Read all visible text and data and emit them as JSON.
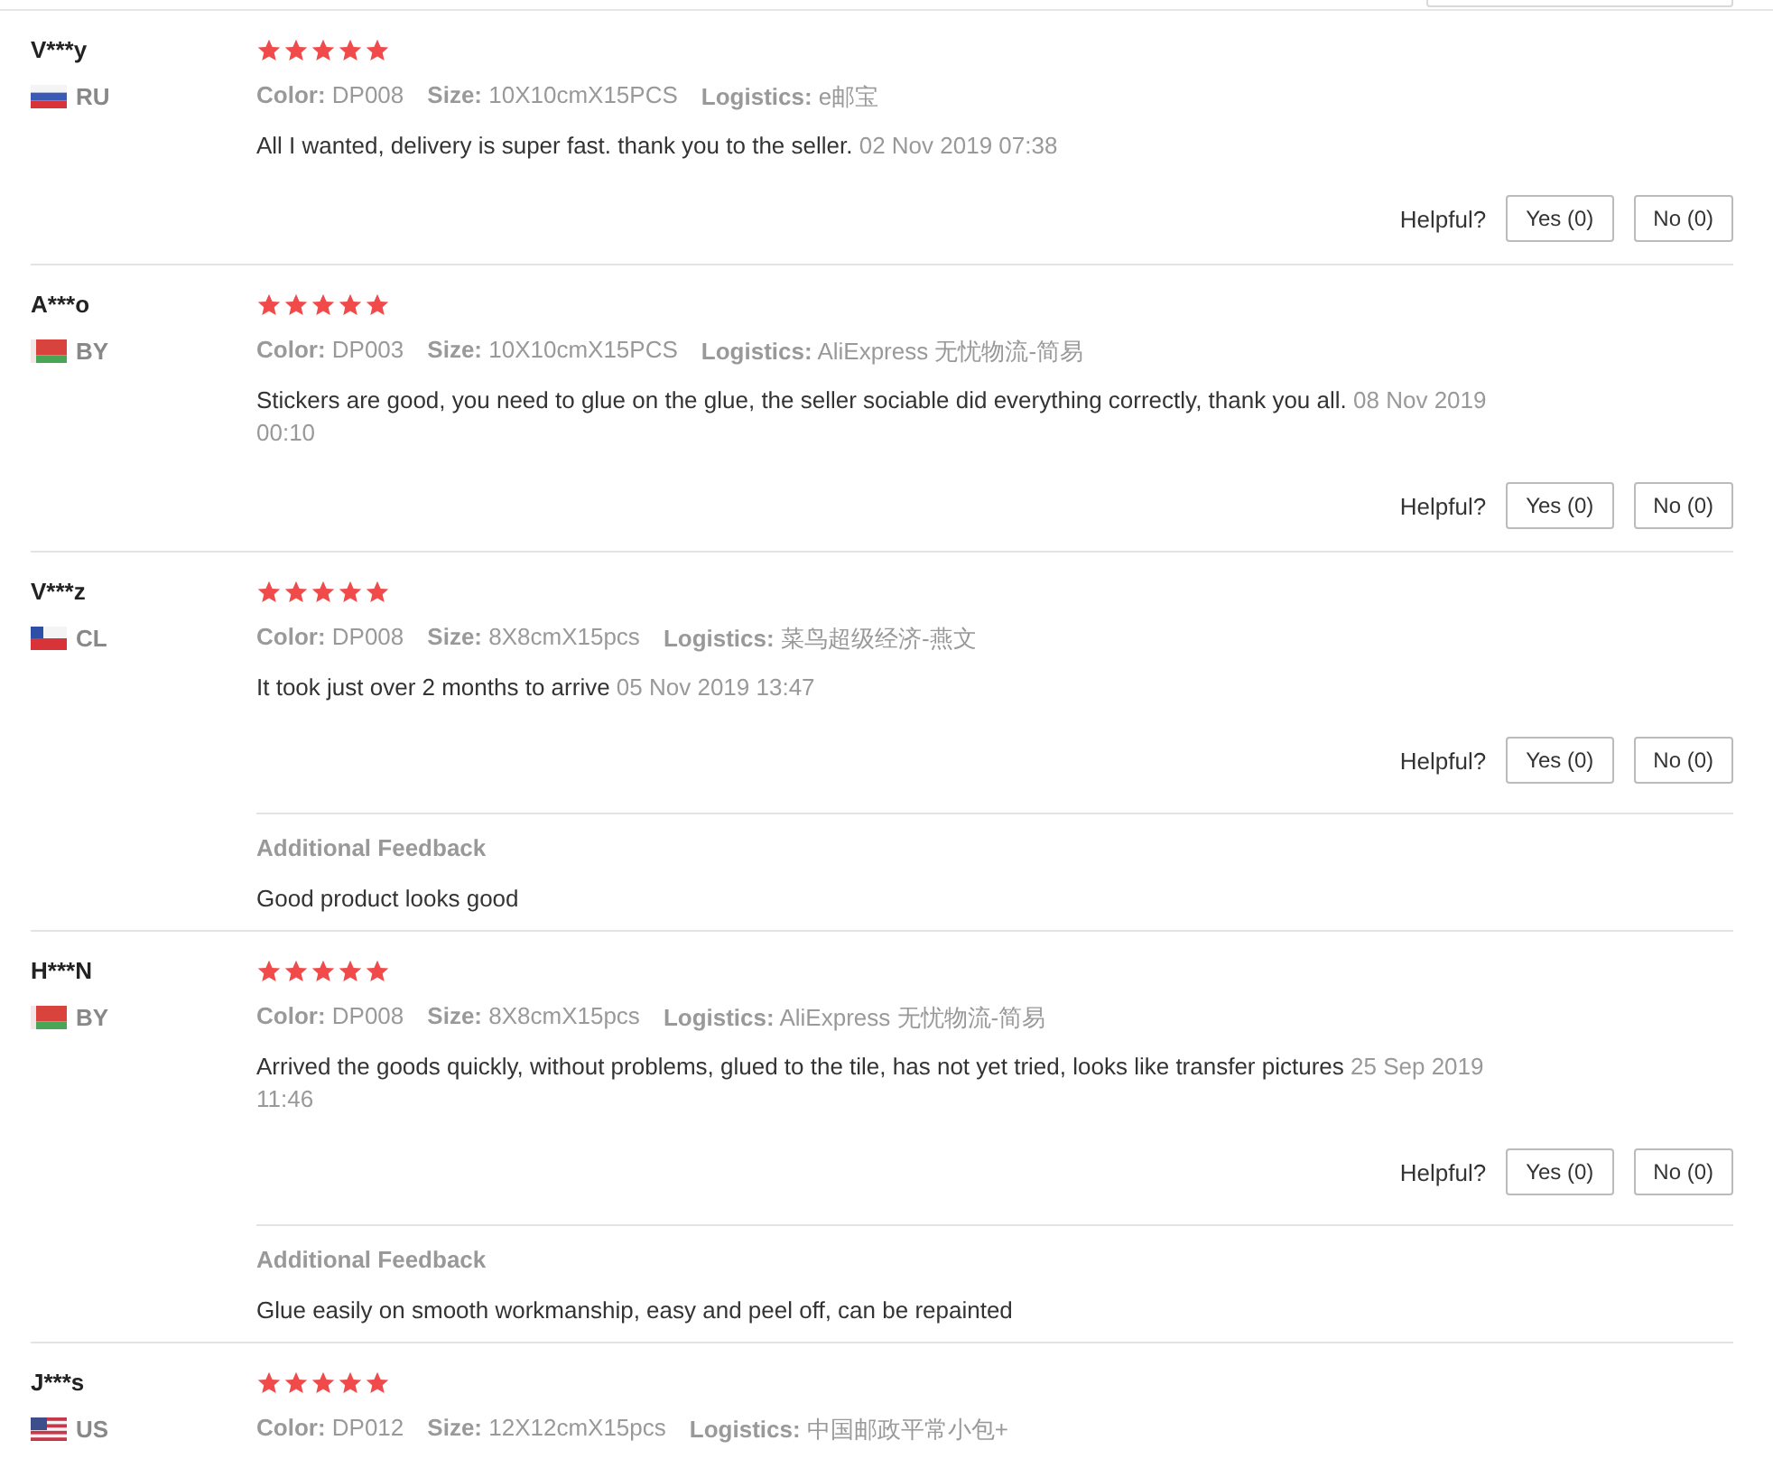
{
  "reviews": [
    {
      "user": "V***y",
      "country": "RU",
      "kind": "ru",
      "stars": 5,
      "meta": [
        {
          "label": "Color:",
          "value": "DP008"
        },
        {
          "label": "Size:",
          "value": "10X10cmX15PCS"
        },
        {
          "label": "Logistics:",
          "value": "e邮宝"
        }
      ],
      "text": "All I wanted, delivery is super fast. thank you to the seller.",
      "date": "02 Nov 2019 07:38",
      "helpful": "Helpful?",
      "yes": "Yes (0)",
      "no": "No (0)"
    },
    {
      "user": "A***o",
      "country": "BY",
      "kind": "by",
      "stars": 5,
      "meta": [
        {
          "label": "Color:",
          "value": "DP003"
        },
        {
          "label": "Size:",
          "value": "10X10cmX15PCS"
        },
        {
          "label": "Logistics:",
          "value": "AliExpress 无忧物流-简易"
        }
      ],
      "text": "Stickers are good, you need to glue on the glue, the seller sociable did everything correctly, thank you all.",
      "date": "08 Nov 2019 00:10",
      "helpful": "Helpful?",
      "yes": "Yes (0)",
      "no": "No (0)"
    },
    {
      "user": "V***z",
      "country": "CL",
      "kind": "cl",
      "stars": 5,
      "meta": [
        {
          "label": "Color:",
          "value": "DP008"
        },
        {
          "label": "Size:",
          "value": "8X8cmX15pcs"
        },
        {
          "label": "Logistics:",
          "value": "菜鸟超级经济-燕文"
        }
      ],
      "text": "It took just over 2 months to arrive",
      "date": "05 Nov 2019 13:47",
      "helpful": "Helpful?",
      "yes": "Yes (0)",
      "no": "No (0)",
      "additional": {
        "title": "Additional Feedback",
        "text": "Good product looks good"
      }
    },
    {
      "user": "H***N",
      "country": "BY",
      "kind": "by",
      "stars": 5,
      "meta": [
        {
          "label": "Color:",
          "value": "DP008"
        },
        {
          "label": "Size:",
          "value": "8X8cmX15pcs"
        },
        {
          "label": "Logistics:",
          "value": "AliExpress 无忧物流-简易"
        }
      ],
      "text": "Arrived the goods quickly, without problems, glued to the tile, has not yet tried, looks like transfer pictures",
      "date": "25 Sep 2019 11:46",
      "helpful": "Helpful?",
      "yes": "Yes (0)",
      "no": "No (0)",
      "additional": {
        "title": "Additional Feedback",
        "text": "Glue easily on smooth workmanship, easy and peel off, can be repainted"
      }
    },
    {
      "user": "J***s",
      "country": "US",
      "kind": "us",
      "stars": 5,
      "meta": [
        {
          "label": "Color:",
          "value": "DP012"
        },
        {
          "label": "Size:",
          "value": "12X12cmX15pcs"
        },
        {
          "label": "Logistics:",
          "value": "中国邮政平常小包+"
        }
      ]
    }
  ]
}
